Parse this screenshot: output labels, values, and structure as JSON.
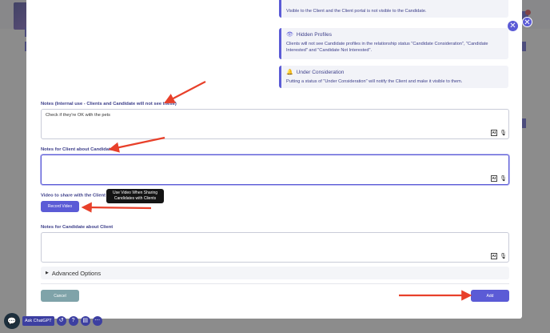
{
  "info_cards": [
    {
      "title": "",
      "body": "Visible to the Client and the Client portal is not visible to the Candidate."
    },
    {
      "title": "Hidden Profiles",
      "icon": "eye-icon",
      "body": "Clients will not see Candidate profiles in the relationship status \"Candidate Consideration\", \"Candidate Interested\" and \"Candidate Not Interested\"."
    },
    {
      "title": "Under Consideration",
      "icon": "bell-icon",
      "body": "Putting a status of \"Under Consideration\" will notify the Client and make it visible to them."
    }
  ],
  "fields": {
    "internal_notes_label": "Notes (Internal use - Clients and Candidate will not see these)",
    "internal_notes_value": "Check if they're OK with the pets",
    "client_notes_label": "Notes for Client about Candidate",
    "client_notes_value": "",
    "video_label": "Video to share with the Client",
    "video_tooltip": "Use Video When Sharing Candidates with Clients",
    "record_video_label": "Record Video",
    "candidate_notes_label": "Notes for Candidate about Client",
    "candidate_notes_value": "",
    "ai_badge": "AI"
  },
  "advanced_label": "Advanced Options",
  "actions": {
    "cancel_label": "Cancel",
    "add_label": "Add"
  },
  "bottom_bar": {
    "ask_label": "Ask ChatGPT"
  },
  "colors": {
    "accent": "#5b5bd6",
    "annotation_arrow": "#e8402a",
    "cancel": "#7fa3a9"
  }
}
